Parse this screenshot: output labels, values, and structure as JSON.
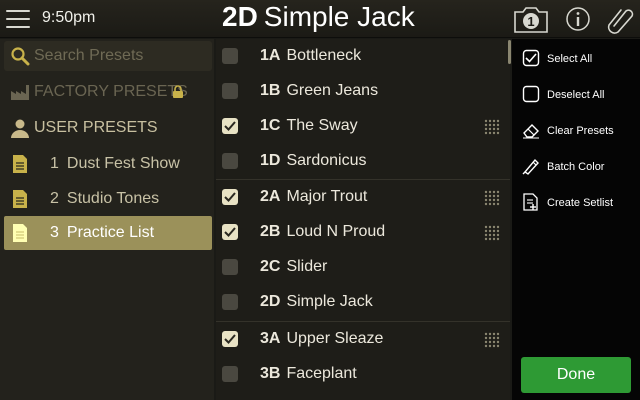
{
  "header": {
    "time": "9:50pm",
    "preset_number": "2D",
    "preset_name": "Simple Jack",
    "snapshot_number": "1"
  },
  "left": {
    "search_placeholder": "Search Presets",
    "factory_label": "FACTORY PRESETS",
    "user_label": "USER PRESETS",
    "setlists": [
      {
        "num": "1",
        "label": "Dust Fest Show",
        "selected": false
      },
      {
        "num": "2",
        "label": "Studio Tones",
        "selected": false
      },
      {
        "num": "3",
        "label": "Practice List",
        "selected": true
      }
    ]
  },
  "presets": [
    {
      "id": "1A",
      "name": "Bottleneck",
      "checked": false
    },
    {
      "id": "1B",
      "name": "Green Jeans",
      "checked": false
    },
    {
      "id": "1C",
      "name": "The Sway",
      "checked": true
    },
    {
      "id": "1D",
      "name": "Sardonicus",
      "checked": false
    },
    {
      "id": "2A",
      "name": "Major Trout",
      "checked": true
    },
    {
      "id": "2B",
      "name": "Loud N Proud",
      "checked": true
    },
    {
      "id": "2C",
      "name": "Slider",
      "checked": false
    },
    {
      "id": "2D",
      "name": "Simple Jack",
      "checked": false
    },
    {
      "id": "3A",
      "name": "Upper Sleaze",
      "checked": true
    },
    {
      "id": "3B",
      "name": "Faceplant",
      "checked": false
    }
  ],
  "actions": {
    "select_all": "Select All",
    "deselect_all": "Deselect All",
    "clear_presets": "Clear Presets",
    "batch_color": "Batch Color",
    "create_setlist": "Create Setlist"
  },
  "done_label": "Done",
  "colors": {
    "accent": "#9b915a",
    "done_green": "#2e9a34"
  }
}
